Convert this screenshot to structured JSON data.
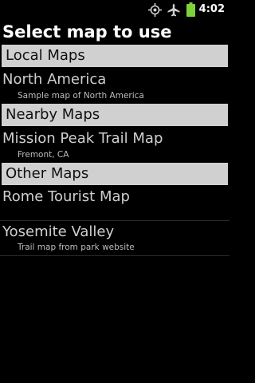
{
  "status_bar": {
    "time": "4:02",
    "icons": [
      "gps-icon",
      "airplane-mode-icon",
      "battery-icon"
    ]
  },
  "header": {
    "title": "Select map to use"
  },
  "sections": [
    {
      "label": "Local Maps",
      "items": [
        {
          "title": "North America",
          "subtitle": "Sample map of North America"
        }
      ]
    },
    {
      "label": "Nearby Maps",
      "items": [
        {
          "title": "Mission Peak Trail Map",
          "subtitle": "Fremont, CA"
        }
      ]
    },
    {
      "label": "Other Maps",
      "items": [
        {
          "title": "Rome Tourist Map",
          "subtitle": ""
        },
        {
          "title": "Yosemite Valley",
          "subtitle": "Trail map from park website"
        }
      ]
    }
  ],
  "colors": {
    "background": "#000000",
    "section_header_bg": "#d0d0d0",
    "battery": "#7fd13b"
  }
}
